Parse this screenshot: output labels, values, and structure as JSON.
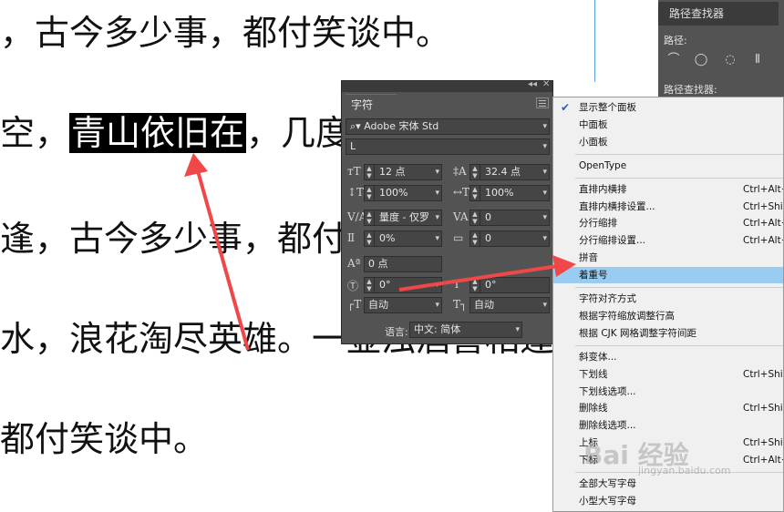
{
  "document": {
    "lines": [
      {
        "pre": "，古今多少事，都付笑谈中。",
        "hl": "",
        "post": ""
      },
      {
        "pre": "空，",
        "hl": "青山依旧在",
        "post": "，几度"
      },
      {
        "pre": "逢，古今多少事，都付",
        "hl": "",
        "post": ""
      },
      {
        "pre": "水，浪花淘尽英雄。一壶浊酒喜相逢",
        "hl": "",
        "post": ""
      },
      {
        "pre": "都付笑谈中。",
        "hl": "",
        "post": ""
      }
    ]
  },
  "pathfinder": {
    "tab": "路径查找器",
    "path_label": "路径:",
    "finder_label": "路径查找器:"
  },
  "character_panel": {
    "collapse": "◂◂",
    "close": "✕",
    "tab": "字符",
    "font_family": "Adobe 宋体 Std",
    "font_style": "L",
    "font_size": "12 点",
    "leading": "32.4 点",
    "vertical_scale": "100%",
    "horizontal_scale": "100%",
    "kerning": "量度 - 仅罗",
    "tracking": "0",
    "tsume": "0%",
    "grid": "0",
    "baseline_shift": "0 点",
    "rotation": "0°",
    "skew": "0°",
    "aki_before": "自动",
    "aki_after": "自动",
    "language_label": "语言:",
    "language": "中文: 简体"
  },
  "context_menu": {
    "items": [
      {
        "label": "显示整个面板",
        "shortcut": "",
        "checked": true
      },
      {
        "label": "中面板",
        "shortcut": ""
      },
      {
        "label": "小面板",
        "shortcut": ""
      },
      {
        "sep": true
      },
      {
        "label": "OpenType",
        "shortcut": ""
      },
      {
        "sep": true
      },
      {
        "label": "直排内横排",
        "shortcut": "Ctrl+Alt+"
      },
      {
        "label": "直排内横排设置...",
        "shortcut": "Ctrl+Shift+"
      },
      {
        "label": "分行缩排",
        "shortcut": "Ctrl+Alt+"
      },
      {
        "label": "分行缩排设置...",
        "shortcut": "Ctrl+Alt+"
      },
      {
        "label": "拼音",
        "shortcut": ""
      },
      {
        "label": "着重号",
        "shortcut": "",
        "selected": true
      },
      {
        "sep": true
      },
      {
        "label": "字符对齐方式",
        "shortcut": ""
      },
      {
        "label": "根据字符缩放调整行高",
        "shortcut": ""
      },
      {
        "label": "根据 CJK 网格调整字符间距",
        "shortcut": ""
      },
      {
        "sep": true
      },
      {
        "label": "斜变体...",
        "shortcut": ""
      },
      {
        "label": "下划线",
        "shortcut": "Ctrl+Shift+"
      },
      {
        "label": "下划线选项...",
        "shortcut": ""
      },
      {
        "label": "删除线",
        "shortcut": "Ctrl+Shift+"
      },
      {
        "label": "删除线选项...",
        "shortcut": ""
      },
      {
        "label": "上标",
        "shortcut": "Ctrl+Shift+"
      },
      {
        "label": "下标",
        "shortcut": "Ctrl+Alt+Shift+"
      },
      {
        "sep": true
      },
      {
        "label": "全部大写字母",
        "shortcut": ""
      },
      {
        "label": "小型大写字母",
        "shortcut": ""
      }
    ]
  },
  "watermark": {
    "text": "Bai 经验",
    "sub": "jingyan.baidu.com"
  },
  "colors": {
    "panel": "#535353",
    "menu_highlight": "#99ccf0",
    "arrow": "#f04848"
  }
}
